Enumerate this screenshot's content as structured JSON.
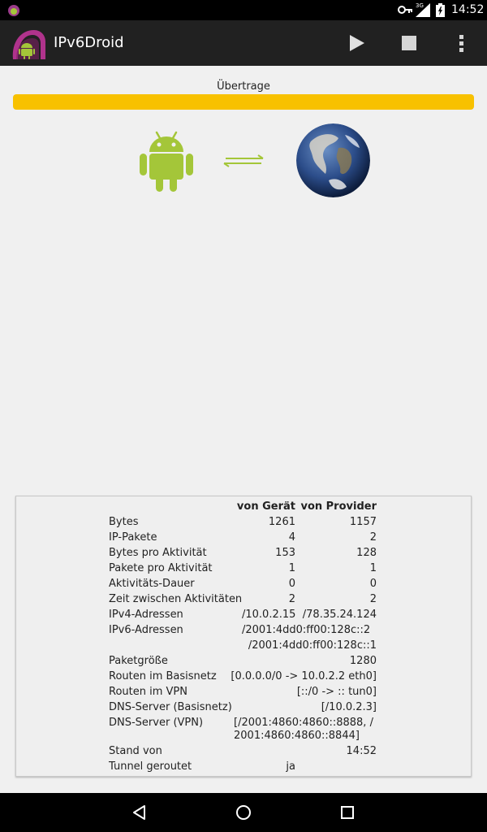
{
  "status_bar": {
    "time": "14:52",
    "network": "3G"
  },
  "action_bar": {
    "title": "IPv6Droid",
    "icons": [
      "play-icon",
      "stop-icon",
      "overflow-menu-icon"
    ]
  },
  "transfer": {
    "label": "Übertrage",
    "progress_percent": 100,
    "progress_color": "#f8c100"
  },
  "stats": {
    "header": {
      "col1": "von Gerät",
      "col2": "von Provider"
    },
    "rows": {
      "bytes": {
        "label": "Bytes",
        "device": "1261",
        "provider": "1157"
      },
      "ip_packets": {
        "label": "IP-Pakete",
        "device": "4",
        "provider": "2"
      },
      "bytes_per_activity": {
        "label": "Bytes pro Aktivität",
        "device": "153",
        "provider": "128"
      },
      "packets_per_activity": {
        "label": "Pakete pro Aktivität",
        "device": "1",
        "provider": "1"
      },
      "activity_duration": {
        "label": "Aktivitäts-Dauer",
        "device": "0",
        "provider": "0"
      },
      "time_between": {
        "label": "Zeit zwischen Aktivitäten",
        "device": "2",
        "provider": "2"
      }
    },
    "ipv4": {
      "label": "IPv4-Adressen",
      "device": "/10.0.2.15",
      "provider": "/78.35.24.124"
    },
    "ipv6": {
      "label": "IPv6-Adressen",
      "device": "/2001:4dd0:ff00:128c::2",
      "provider": "/2001:4dd0:ff00:128c::1"
    },
    "packet_size": {
      "label": "Paketgröße",
      "value": "1280"
    },
    "routes_base": {
      "label": "Routen im Basisnetz",
      "value": "[0.0.0.0/0 -> 10.0.2.2 eth0]"
    },
    "routes_vpn": {
      "label": "Routen im VPN",
      "value": "[::/0 -> :: tun0]"
    },
    "dns_base": {
      "label": "DNS-Server (Basisnetz)",
      "value": "[/10.0.2.3]"
    },
    "dns_vpn": {
      "label": "DNS-Server (VPN)",
      "value_line1": "[/2001:4860:4860::8888, /",
      "value_line2": "2001:4860:4860::8844]"
    },
    "since": {
      "label": "Stand von",
      "value": "14:52"
    },
    "tunnel_routed": {
      "label": "Tunnel geroutet",
      "value": "ja"
    }
  },
  "nav_bar": {
    "icons": [
      "back-icon",
      "home-icon",
      "recent-apps-icon"
    ]
  }
}
